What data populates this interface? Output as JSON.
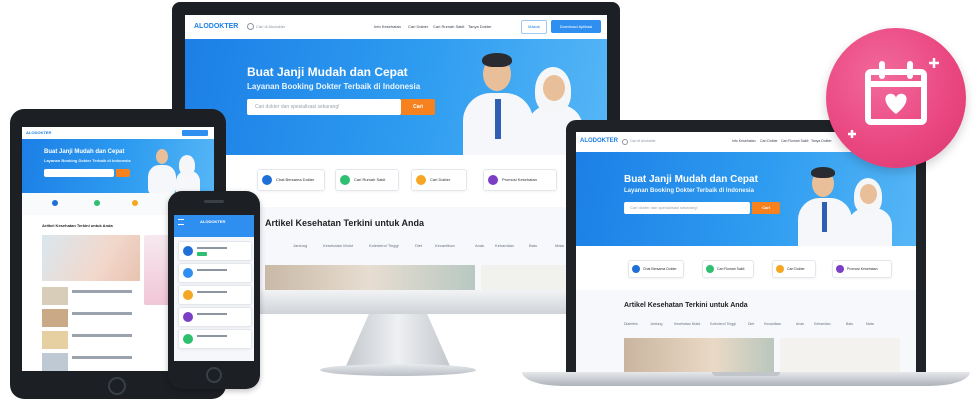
{
  "brand": "ALODOKTER",
  "search_placeholder": "Cari di Alodokter",
  "nav": {
    "links": [
      "Info Kesehatan",
      "Cari Dokter",
      "Cari Rumah Sakit",
      "Tanya Dokter"
    ],
    "masuk": "Masuk",
    "download": "Download Aplikasi"
  },
  "hero": {
    "title": "Buat Janji Mudah dan Cepat",
    "subtitle": "Layanan Booking Dokter Terbaik di Indonesia",
    "search_placeholder": "Cari dokter dan spesialisasi sekarang!",
    "search_button": "Cari"
  },
  "services": [
    {
      "label": "Chat Bersama Dokter",
      "icon": "chat-icon",
      "color": "#1f6fd6"
    },
    {
      "label": "Cari Rumah Sakit",
      "icon": "hospital-icon",
      "color": "#2fbf71"
    },
    {
      "label": "Cari Dokter",
      "icon": "doctor-icon",
      "color": "#f5a623"
    },
    {
      "label": "Promosi Kesehatan",
      "icon": "promo-icon",
      "color": "#7b3fc6"
    }
  ],
  "articles": {
    "heading": "Artikel Kesehatan Terkini untuk Anda",
    "categories": [
      "Diabetes",
      "Jantung",
      "Kesehatan Mulut",
      "Kolesterol Tinggi",
      "Diet",
      "Kecantikan",
      "Anak",
      "Kehamilan",
      "Batu",
      "Mata"
    ]
  },
  "tablet": {
    "heading": "Artikel Kesehatan Terkini untuk Anda"
  },
  "badge": {
    "icon": "calendar-heart-icon",
    "color": "#e9457f"
  }
}
